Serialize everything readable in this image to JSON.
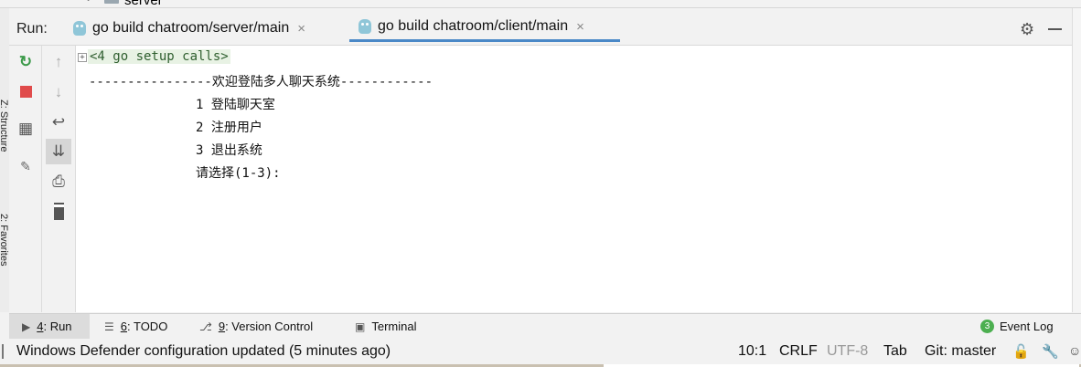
{
  "tree": {
    "folder_label": "server"
  },
  "side_tabs": {
    "structure": "Z: Structure",
    "favorites": "2: Favorites"
  },
  "run_panel": {
    "run_label": "Run:",
    "tabs": [
      {
        "label": "go build chatroom/server/main",
        "active": false
      },
      {
        "label": "go build chatroom/client/main",
        "active": true
      }
    ],
    "close_glyph": "×",
    "gear_glyph": "⚙"
  },
  "toolbar_glyphs": {
    "rerun": "↻",
    "stop": "■",
    "layout": "▦",
    "pin": "📌",
    "up": "↑",
    "down": "↓",
    "wrap": "↩",
    "scroll_end": "⇊",
    "print": "⎙",
    "trash": "🗑"
  },
  "console": {
    "fold": "+",
    "setup_calls": "<4 go setup calls>",
    "lines": [
      "----------------欢迎登陆多人聊天系统------------",
      "1 登陆聊天室",
      "2 注册用户",
      "3 退出系统",
      "请选择(1-3):"
    ]
  },
  "tool_windows": {
    "run": {
      "key": "4",
      "label": ": Run"
    },
    "todo": {
      "key": "6",
      "label": ": TODO"
    },
    "vcs": {
      "key": "9",
      "label": ": Version Control"
    },
    "terminal": {
      "label": "Terminal"
    },
    "event_log": {
      "count": "3",
      "label": "Event Log"
    }
  },
  "status_bar": {
    "message": "Windows Defender configuration updated (5 minutes ago)",
    "position": "10:1",
    "line_sep": "CRLF",
    "encoding": "UTF-8",
    "indent": "Tab",
    "git": "Git: master"
  },
  "colors": {
    "accent": "#4a88c7",
    "stop_red": "#e04b4b",
    "rerun_green": "#3c9a4a",
    "event_green": "#4caf50"
  }
}
